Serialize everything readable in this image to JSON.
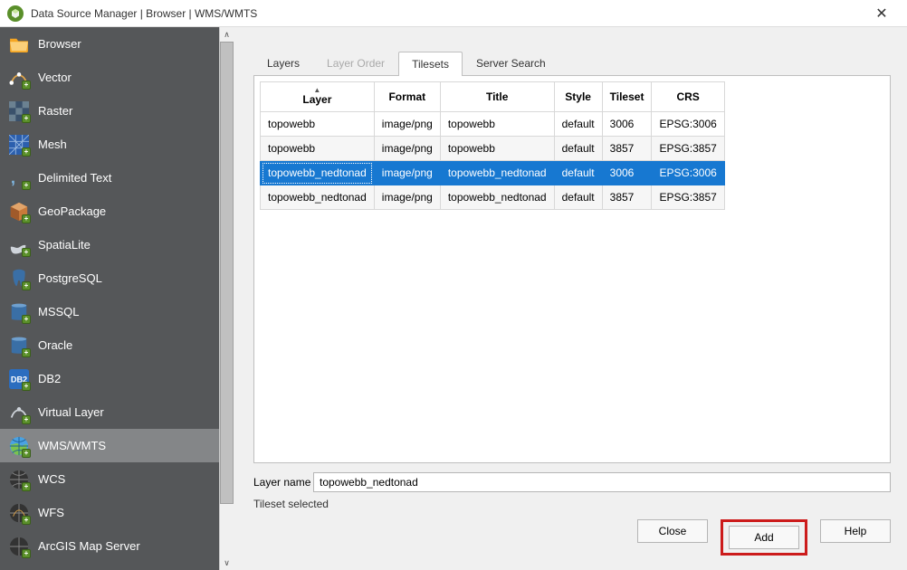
{
  "window": {
    "title": "Data Source Manager | Browser | WMS/WMTS"
  },
  "sidebar": {
    "items": [
      {
        "label": "Browser",
        "icon": "folder-icon",
        "active": false
      },
      {
        "label": "Vector",
        "icon": "vector-icon",
        "active": false
      },
      {
        "label": "Raster",
        "icon": "raster-icon",
        "active": false
      },
      {
        "label": "Mesh",
        "icon": "mesh-icon",
        "active": false
      },
      {
        "label": "Delimited Text",
        "icon": "comma-icon",
        "active": false
      },
      {
        "label": "GeoPackage",
        "icon": "geopackage-icon",
        "active": false
      },
      {
        "label": "SpatiaLite",
        "icon": "spatialite-icon",
        "active": false
      },
      {
        "label": "PostgreSQL",
        "icon": "postgres-icon",
        "active": false
      },
      {
        "label": "MSSQL",
        "icon": "mssql-icon",
        "active": false
      },
      {
        "label": "Oracle",
        "icon": "oracle-icon",
        "active": false
      },
      {
        "label": "DB2",
        "icon": "db2-icon",
        "active": false
      },
      {
        "label": "Virtual Layer",
        "icon": "virtual-icon",
        "active": false
      },
      {
        "label": "WMS/WMTS",
        "icon": "wms-icon",
        "active": true
      },
      {
        "label": "WCS",
        "icon": "wcs-icon",
        "active": false
      },
      {
        "label": "WFS",
        "icon": "wfs-icon",
        "active": false
      },
      {
        "label": "ArcGIS Map Server",
        "icon": "arcgis-icon",
        "active": false
      }
    ]
  },
  "tabs": [
    {
      "label": "Layers",
      "active": false,
      "disabled": false
    },
    {
      "label": "Layer Order",
      "active": false,
      "disabled": true
    },
    {
      "label": "Tilesets",
      "active": true,
      "disabled": false
    },
    {
      "label": "Server Search",
      "active": false,
      "disabled": false
    }
  ],
  "table": {
    "headers": [
      "Layer",
      "Format",
      "Title",
      "Style",
      "Tileset",
      "CRS"
    ],
    "rows": [
      {
        "cells": [
          "topowebb",
          "image/png",
          "topowebb",
          "default",
          "3006",
          "EPSG:3006"
        ],
        "selected": false,
        "alt": false
      },
      {
        "cells": [
          "topowebb",
          "image/png",
          "topowebb",
          "default",
          "3857",
          "EPSG:3857"
        ],
        "selected": false,
        "alt": true
      },
      {
        "cells": [
          "topowebb_nedtonad",
          "image/png",
          "topowebb_nedtonad",
          "default",
          "3006",
          "EPSG:3006"
        ],
        "selected": true,
        "alt": false
      },
      {
        "cells": [
          "topowebb_nedtonad",
          "image/png",
          "topowebb_nedtonad",
          "default",
          "3857",
          "EPSG:3857"
        ],
        "selected": false,
        "alt": true
      }
    ]
  },
  "layer_name_label": "Layer name",
  "layer_name_value": "topowebb_nedtonad",
  "status_text": "Tileset selected",
  "buttons": {
    "close": "Close",
    "add": "Add",
    "help": "Help"
  }
}
